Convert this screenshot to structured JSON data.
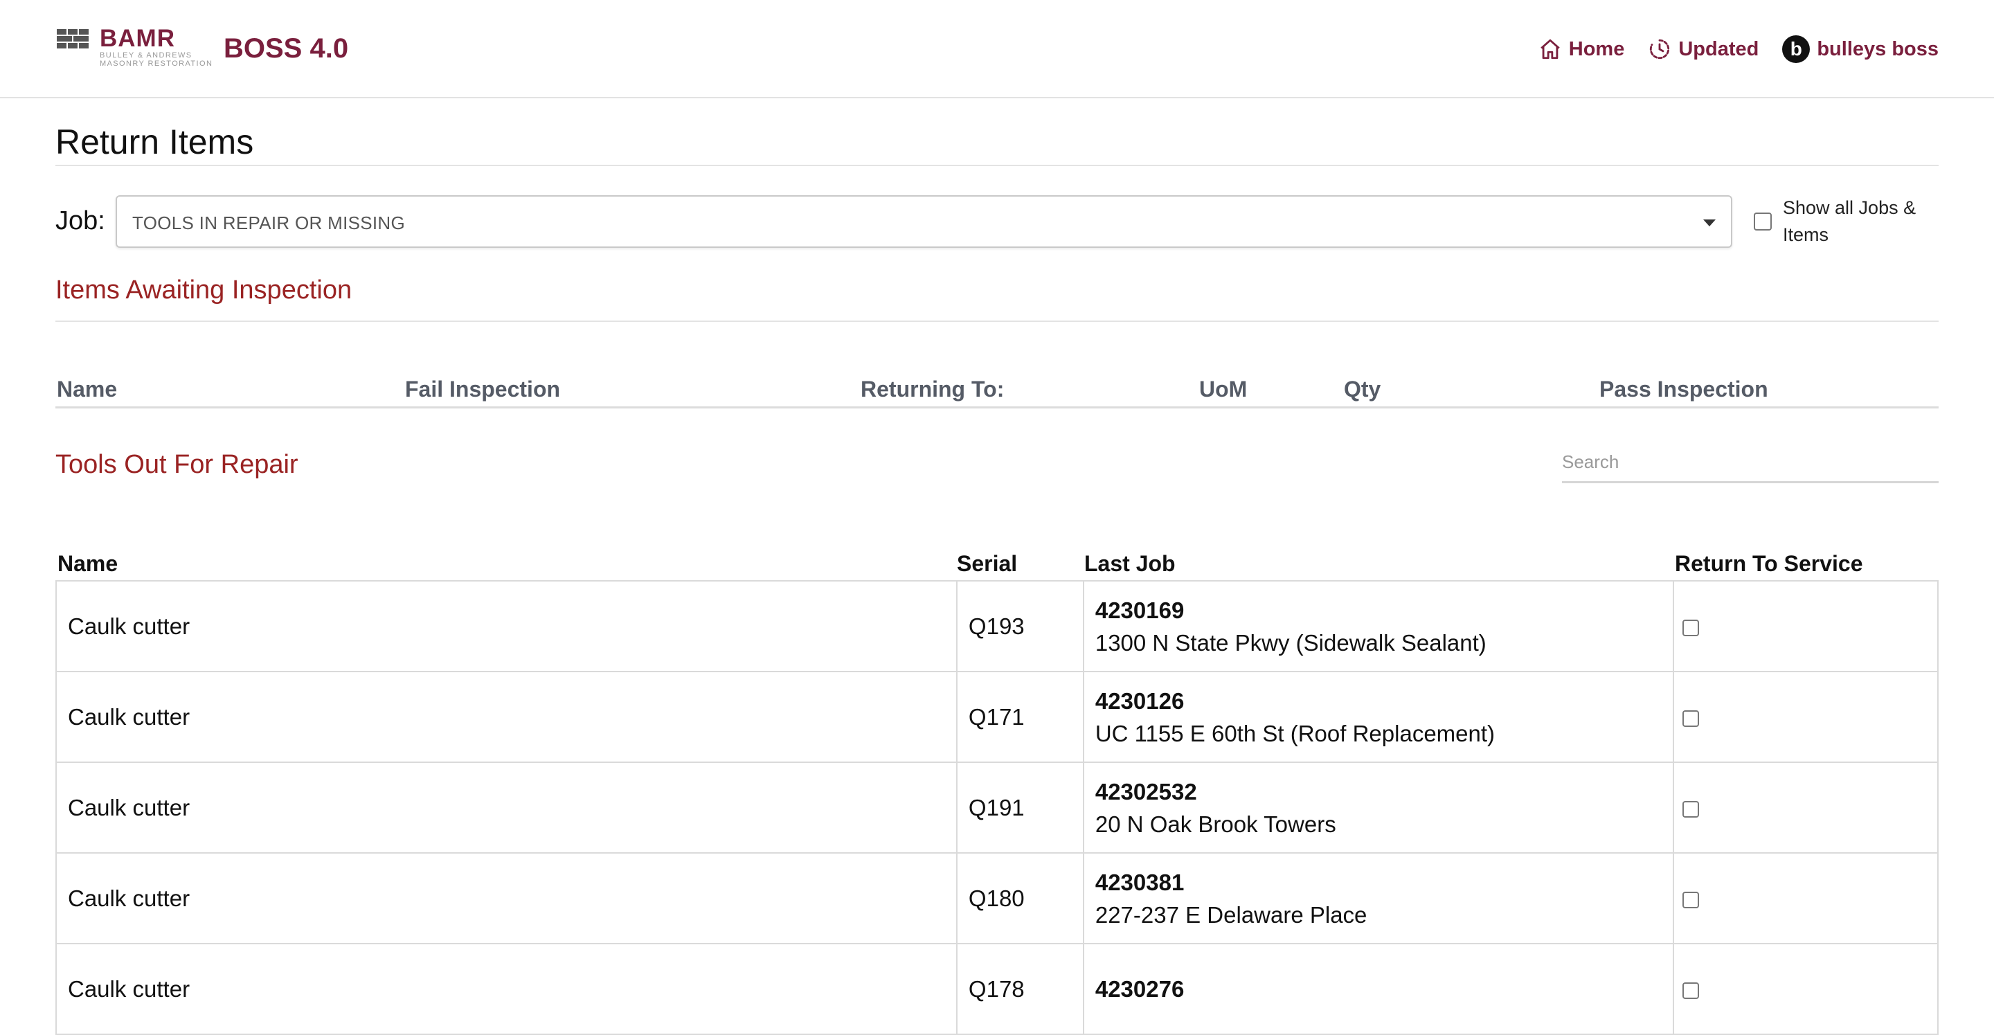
{
  "header": {
    "logo_text": "BAMR",
    "logo_subtext_1": "BULLEY & ANDREWS",
    "logo_subtext_2": "MASONRY RESTORATION",
    "app_title": "BOSS 4.0",
    "nav": {
      "home": "Home",
      "updated": "Updated",
      "user_initial": "b",
      "user_name": "bulleys boss"
    }
  },
  "page": {
    "title": "Return Items"
  },
  "job": {
    "label": "Job:",
    "selected": "TOOLS IN REPAIR OR MISSING",
    "show_all_label": "Show all Jobs & Items",
    "show_all_checked": false
  },
  "inspection": {
    "heading": "Items Awaiting Inspection",
    "columns": {
      "name": "Name",
      "fail": "Fail Inspection",
      "returning": "Returning To:",
      "uom": "UoM",
      "qty": "Qty",
      "pass": "Pass Inspection"
    },
    "rows": []
  },
  "repair": {
    "heading": "Tools Out For Repair",
    "search_placeholder": "Search",
    "columns": {
      "name": "Name",
      "serial": "Serial",
      "last_job": "Last Job",
      "return_to_service": "Return To Service"
    },
    "rows": [
      {
        "name": "Caulk cutter",
        "serial": "Q193",
        "job_number": "4230169",
        "job_name": "1300 N State Pkwy (Sidewalk Sealant)",
        "checked": false
      },
      {
        "name": "Caulk cutter",
        "serial": "Q171",
        "job_number": "4230126",
        "job_name": "UC 1155 E 60th St (Roof Replacement)",
        "checked": false
      },
      {
        "name": "Caulk cutter",
        "serial": "Q191",
        "job_number": "42302532",
        "job_name": "20 N Oak Brook Towers",
        "checked": false
      },
      {
        "name": "Caulk cutter",
        "serial": "Q180",
        "job_number": "4230381",
        "job_name": "227-237 E Delaware Place",
        "checked": false
      },
      {
        "name": "Caulk cutter",
        "serial": "Q178",
        "job_number": "4230276",
        "job_name": "",
        "checked": false
      }
    ]
  }
}
